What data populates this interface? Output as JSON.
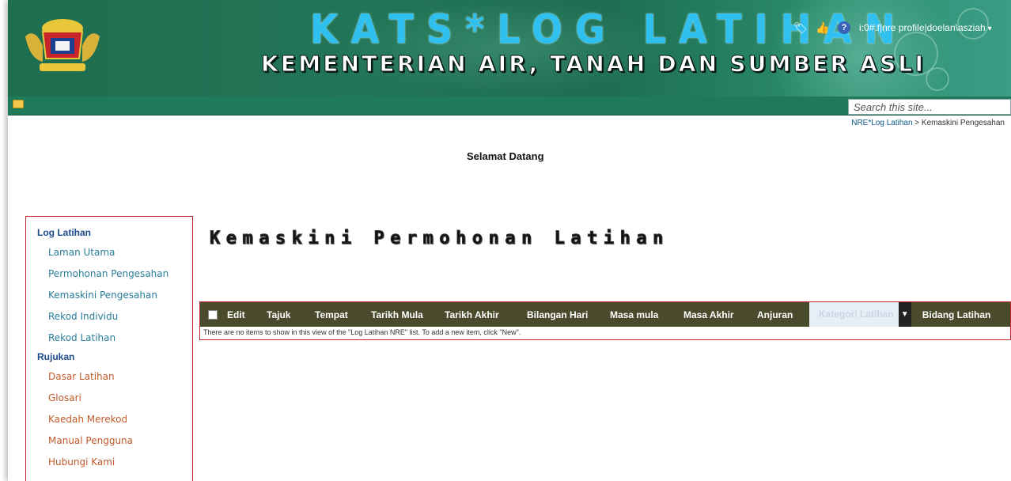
{
  "header": {
    "title": "KATS*LOG LATIHAN",
    "subtitle": "KEMENTERIAN AIR, TANAH DAN SUMBER ASLI",
    "user": "i:0#.f|nre profile|doelan\\asziah",
    "icons": [
      "tag-icon",
      "feedback-icon",
      "help-icon"
    ]
  },
  "search": {
    "placeholder": "Search this site..."
  },
  "breadcrumb": {
    "root": "NRE*Log Latihan",
    "sep": ">",
    "current": "Kemaskini Pengesahan"
  },
  "welcome": "Selamat Datang",
  "sidebar": {
    "sections": [
      {
        "heading": "Log Latihan",
        "items": [
          "Laman Utama",
          "Permohonan Pengesahan",
          "Kemaskini Pengesahan",
          "Rekod Individu",
          "Rekod Latihan"
        ]
      },
      {
        "heading": "Rujukan",
        "items": [
          "Dasar Latihan",
          "Glosari",
          "Kaedah Merekod",
          "Manual Pengguna",
          "Hubungi Kami"
        ]
      }
    ]
  },
  "page_title": "Kemaskini Permohonan Latihan",
  "list": {
    "columns": [
      "Edit",
      "Tajuk",
      "Tempat",
      "Tarikh Mula",
      "Tarikh Akhir",
      "Bilangan Hari",
      "Masa mula",
      "Masa Akhir",
      "Anjuran",
      "Kategori Latihan",
      "Bidang Latihan"
    ],
    "empty_message": "There are no items to show in this view of the \"Log Latihan NRE\" list. To add a new item, click \"New\"."
  },
  "colors": {
    "banner": "#1f6d4f",
    "navbar": "#1f7a5a",
    "table_header": "#4a4a2c",
    "nav_border": "#c0282d"
  }
}
